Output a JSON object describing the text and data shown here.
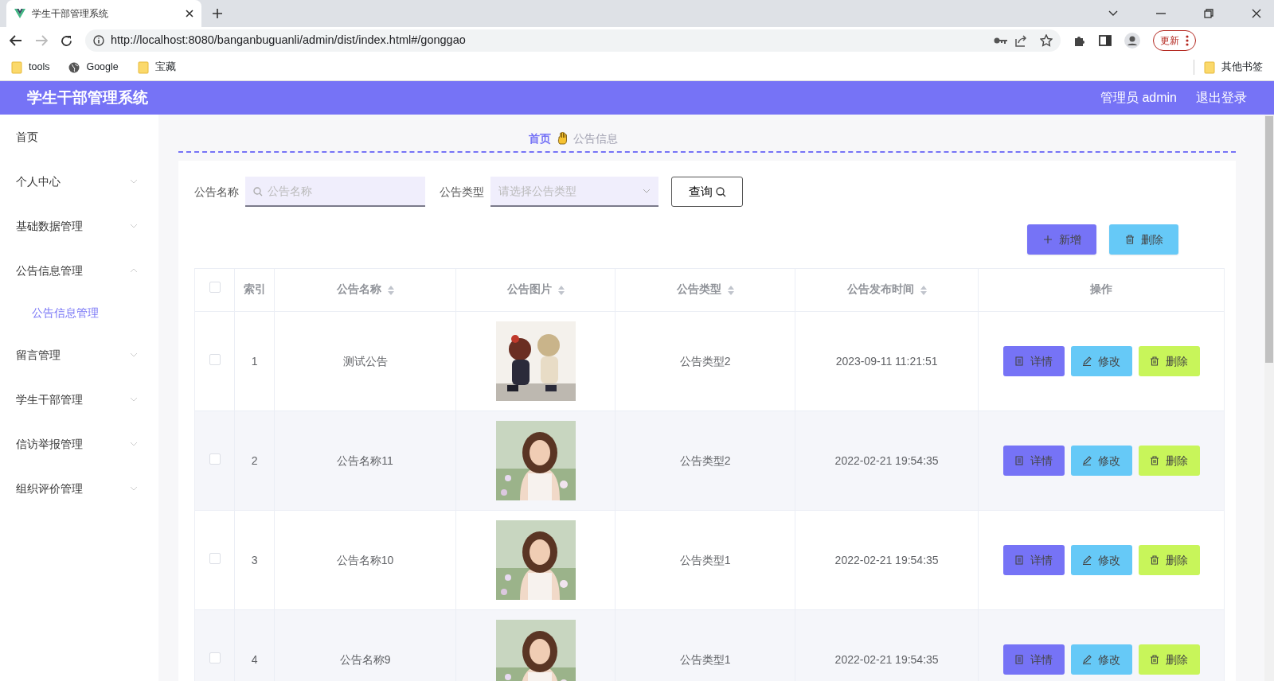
{
  "browser": {
    "tab_title": "学生干部管理系统",
    "url": "http://localhost:8080/banganbuguanli/admin/dist/index.html#/gonggao",
    "update_button": "更新",
    "bookmarks": [
      {
        "label": "tools",
        "kind": "folder"
      },
      {
        "label": "Google",
        "kind": "globe"
      },
      {
        "label": "宝藏",
        "kind": "folder"
      }
    ],
    "other_bookmarks": "其他书签"
  },
  "header": {
    "title": "学生干部管理系统",
    "user": "管理员 admin",
    "logout": "退出登录"
  },
  "sidebar": {
    "items": [
      {
        "label": "首页",
        "kind": "link"
      },
      {
        "label": "个人中心",
        "kind": "menu",
        "expanded": false
      },
      {
        "label": "基础数据管理",
        "kind": "menu",
        "expanded": false
      },
      {
        "label": "公告信息管理",
        "kind": "menu",
        "expanded": true,
        "children": [
          {
            "label": "公告信息管理",
            "selected": true
          }
        ]
      },
      {
        "label": "留言管理",
        "kind": "menu",
        "expanded": false
      },
      {
        "label": "学生干部管理",
        "kind": "menu",
        "expanded": false
      },
      {
        "label": "信访举报管理",
        "kind": "menu",
        "expanded": false
      },
      {
        "label": "组织评价管理",
        "kind": "menu",
        "expanded": false
      }
    ]
  },
  "breadcrumb": [
    "首页",
    "公告信息"
  ],
  "search": {
    "fields": [
      {
        "label": "公告名称",
        "placeholder": "公告名称",
        "kind": "text"
      },
      {
        "label": "公告类型",
        "placeholder": "请选择公告类型",
        "kind": "select"
      }
    ],
    "query_button": "查询"
  },
  "actions": [
    {
      "label": "新增",
      "kind": "add"
    },
    {
      "label": "删除",
      "kind": "delete"
    }
  ],
  "table": {
    "all_checked": false,
    "columns": [
      {
        "label": "索引",
        "sortable": false
      },
      {
        "label": "公告名称",
        "sortable": true
      },
      {
        "label": "公告图片",
        "sortable": true
      },
      {
        "label": "公告类型",
        "sortable": true
      },
      {
        "label": "公告发布时间",
        "sortable": true
      },
      {
        "label": "操作",
        "sortable": false
      }
    ],
    "rows": [
      {
        "checked": false,
        "index": "1",
        "name": "测试公告",
        "picture": {
          "kind": "picture"
        },
        "type": "公告类型2",
        "time": "2023-09-11 11:21:51",
        "actions": [
          {
            "label": "详情",
            "kind": "detail"
          },
          {
            "label": "修改",
            "kind": "edit"
          },
          {
            "label": "删除",
            "kind": "delete"
          }
        ]
      },
      {
        "checked": false,
        "index": "2",
        "name": "公告名称11",
        "picture": {
          "kind": "picture"
        },
        "type": "公告类型2",
        "time": "2022-02-21 19:54:35",
        "actions": [
          {
            "label": "详情",
            "kind": "detail"
          },
          {
            "label": "修改",
            "kind": "edit"
          },
          {
            "label": "删除",
            "kind": "delete"
          }
        ]
      },
      {
        "checked": false,
        "index": "3",
        "name": "公告名称10",
        "picture": {
          "kind": "picture"
        },
        "type": "公告类型1",
        "time": "2022-02-21 19:54:35",
        "actions": [
          {
            "label": "详情",
            "kind": "detail"
          },
          {
            "label": "修改",
            "kind": "edit"
          },
          {
            "label": "删除",
            "kind": "delete"
          }
        ]
      },
      {
        "checked": false,
        "index": "4",
        "name": "公告名称9",
        "picture": {
          "kind": "picture"
        },
        "type": "公告类型1",
        "time": "2022-02-21 19:54:35",
        "actions": [
          {
            "label": "详情",
            "kind": "detail"
          },
          {
            "label": "修改",
            "kind": "edit"
          },
          {
            "label": "删除",
            "kind": "delete"
          }
        ]
      }
    ]
  }
}
